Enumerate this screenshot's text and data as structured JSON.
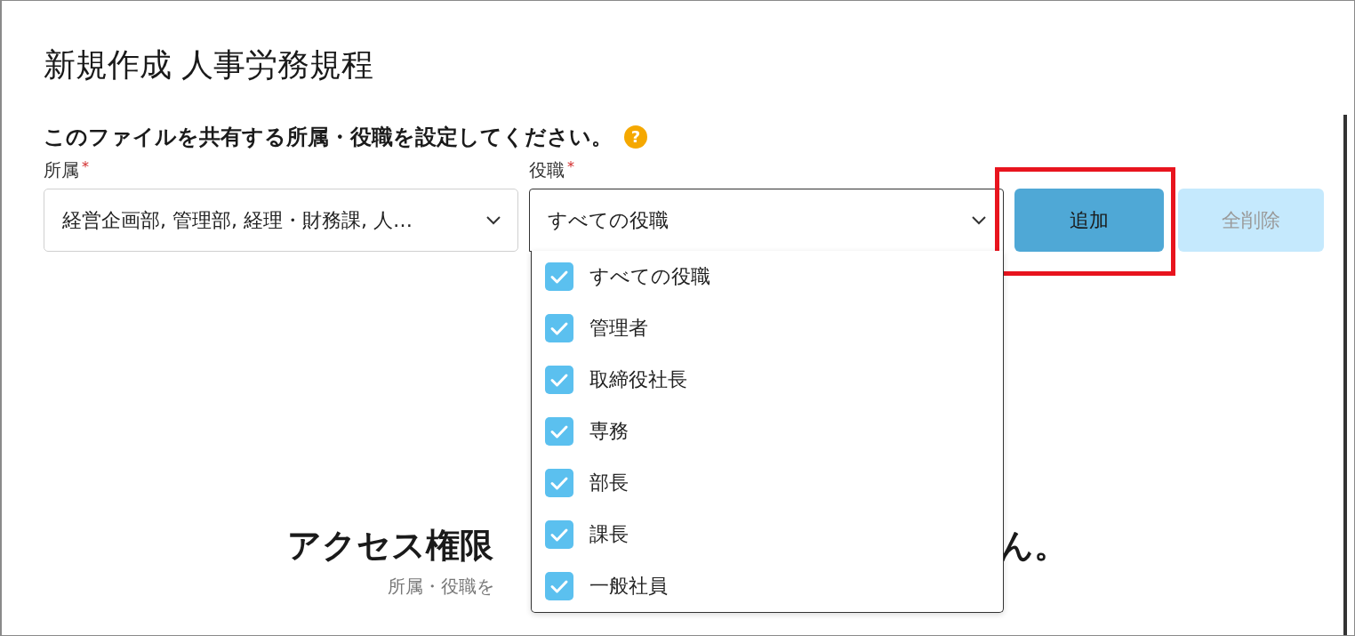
{
  "title": "新規作成 人事労務規程",
  "instruction": "このファイルを共有する所属・役職を設定してください。",
  "help_glyph": "?",
  "fields": [
    {
      "label": "所属",
      "required_mark": "*",
      "value": "経営企画部, 管理部, 経理・財務課, 人…",
      "expanded": false
    },
    {
      "label": "役職",
      "required_mark": "*",
      "value": "すべての役職",
      "expanded": true
    }
  ],
  "buttons": [
    {
      "label": "追加",
      "disabled": false,
      "highlighted": true
    },
    {
      "label": "全削除",
      "disabled": true,
      "highlighted": false
    }
  ],
  "options": [
    {
      "label": "すべての役職",
      "checked": true
    },
    {
      "label": "管理者",
      "checked": true
    },
    {
      "label": "取締役社長",
      "checked": true
    },
    {
      "label": "専務",
      "checked": true
    },
    {
      "label": "部長",
      "checked": true
    },
    {
      "label": "課長",
      "checked": true
    },
    {
      "label": "一般社員",
      "checked": true
    }
  ],
  "empty_state": {
    "heading_start": "アクセス権限",
    "heading_end": "ん。",
    "hint": "所属・役職を"
  }
}
